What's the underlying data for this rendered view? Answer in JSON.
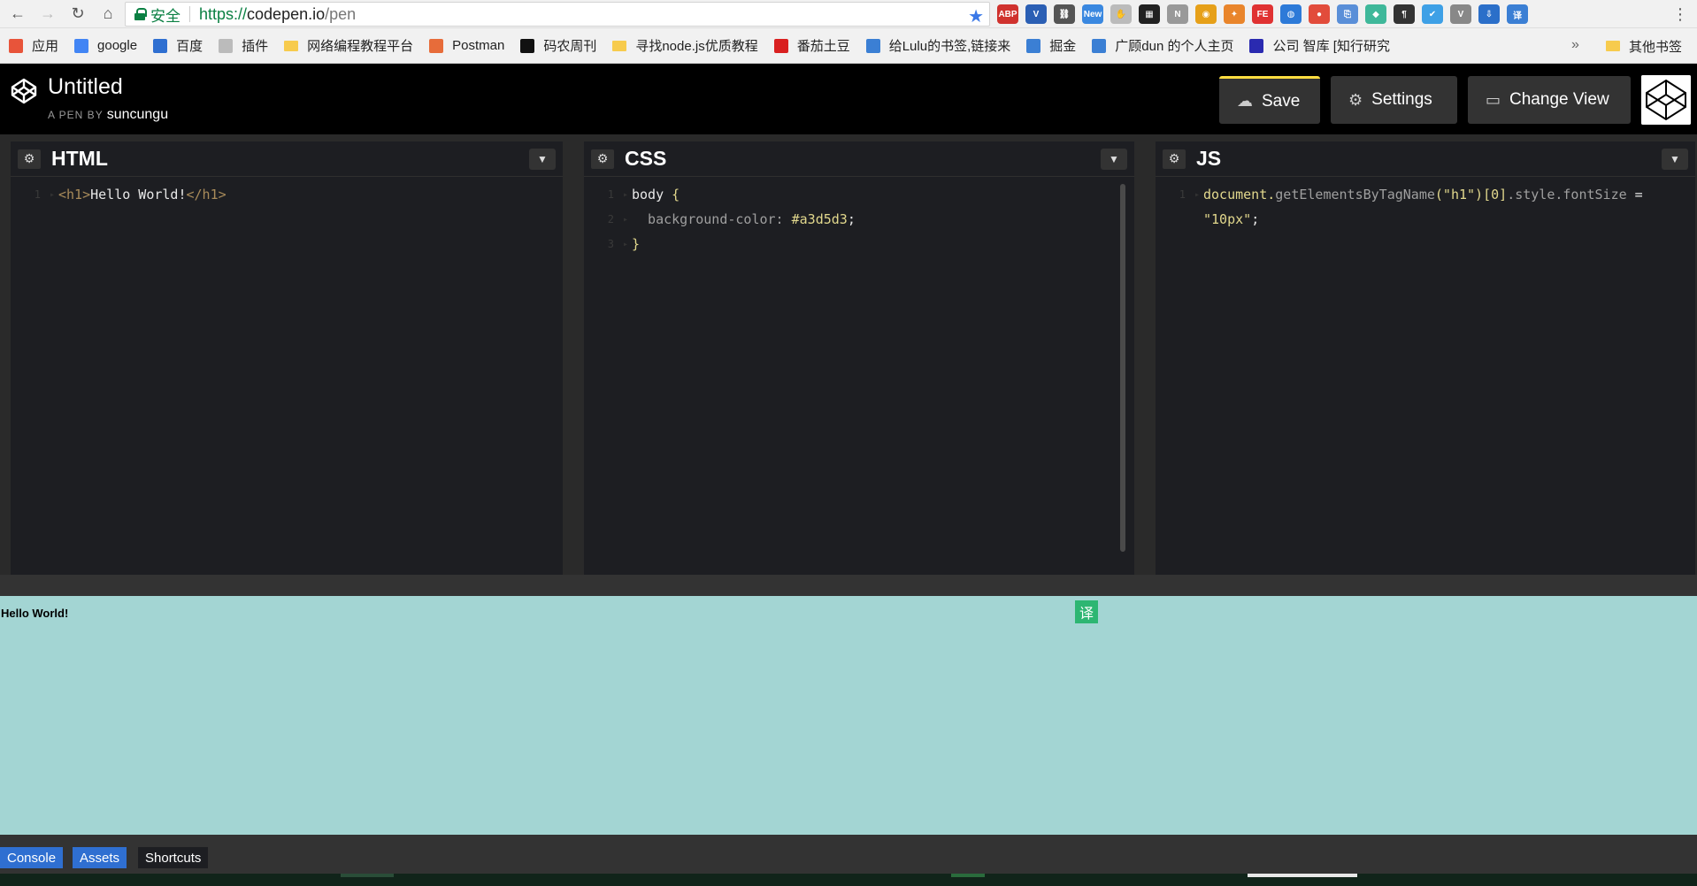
{
  "browser": {
    "secure_label": "安全",
    "url_scheme": "https://",
    "url_host": "codepen.io",
    "url_path": "/pen",
    "extensions": [
      {
        "name": "abp-icon",
        "label": "ABP",
        "color": "#d0322e"
      },
      {
        "name": "vue-icon",
        "label": "V",
        "color": "#2b5fb4"
      },
      {
        "name": "link-icon",
        "label": "⛓",
        "color": "#555555"
      },
      {
        "name": "new-icon",
        "label": "New",
        "color": "#3a88e0"
      },
      {
        "name": "hand-icon",
        "label": "✋",
        "color": "#bbbbbb"
      },
      {
        "name": "qr-icon",
        "label": "▦",
        "color": "#222222"
      },
      {
        "name": "n-icon",
        "label": "N",
        "color": "#999999"
      },
      {
        "name": "chrome-icon",
        "label": "◉",
        "color": "#e6a019"
      },
      {
        "name": "puzzle-icon",
        "label": "✦",
        "color": "#e9852b"
      },
      {
        "name": "fe-icon",
        "label": "FE",
        "color": "#e03232"
      },
      {
        "name": "globe-icon",
        "label": "◍",
        "color": "#2d7ad8"
      },
      {
        "name": "pin-icon",
        "label": "●",
        "color": "#e24c3b"
      },
      {
        "name": "clip-icon",
        "label": "⎘",
        "color": "#5a8fd8"
      },
      {
        "name": "diamond-icon",
        "label": "◆",
        "color": "#3fb89a"
      },
      {
        "name": "pilcrow-icon",
        "label": "¶",
        "color": "#333333"
      },
      {
        "name": "check-icon",
        "label": "✔",
        "color": "#3ea0e6"
      },
      {
        "name": "v-icon",
        "label": "V",
        "color": "#888888"
      },
      {
        "name": "down-icon",
        "label": "⇩",
        "color": "#2b6fc9"
      },
      {
        "name": "translate-ext-icon",
        "label": "译",
        "color": "#3b7fd4"
      }
    ]
  },
  "bookmarks": [
    {
      "name": "apps",
      "label": "应用",
      "color": "#e8543a"
    },
    {
      "name": "google",
      "label": "google",
      "color": "#4285f4"
    },
    {
      "name": "baidu",
      "label": "百度",
      "color": "#2f6fd1"
    },
    {
      "name": "plugins",
      "label": "插件",
      "color": "#bbbbbb"
    },
    {
      "name": "folder-1",
      "label": "网络编程教程平台",
      "folder": true
    },
    {
      "name": "postman",
      "label": "Postman",
      "color": "#e76c3a"
    },
    {
      "name": "mano",
      "label": "码农周刊",
      "color": "#111111"
    },
    {
      "name": "folder-2",
      "label": "寻找node.js优质教程",
      "folder": true
    },
    {
      "name": "tomato",
      "label": "番茄土豆",
      "color": "#d92020"
    },
    {
      "name": "lulu",
      "label": "给Lulu的书签,链接来",
      "color": "#3b7fd4"
    },
    {
      "name": "juejin",
      "label": "掘金",
      "color": "#3b7fd4"
    },
    {
      "name": "guanggudun",
      "label": "广顾dun 的个人主页",
      "color": "#3b7fd4"
    },
    {
      "name": "zhiku",
      "label": "公司 智库 [知行研究",
      "color": "#2a2ab0"
    }
  ],
  "bookmarks_more": "»",
  "bookmarks_other": "其他书签",
  "pen": {
    "title": "Untitled",
    "by_label": "A PEN BY",
    "author": "suncungu"
  },
  "header_buttons": {
    "save": "Save",
    "settings": "Settings",
    "change_view": "Change View"
  },
  "editors": {
    "html": {
      "label": "HTML",
      "lines": [
        {
          "n": "1",
          "parts": [
            {
              "t": "<h1>",
              "c": "c-tag"
            },
            {
              "t": "Hello World!",
              "c": "c-text"
            },
            {
              "t": "</h1>",
              "c": "c-tag"
            }
          ]
        }
      ]
    },
    "css": {
      "label": "CSS",
      "lines": [
        {
          "n": "1",
          "parts": [
            {
              "t": "body ",
              "c": "c-sel"
            },
            {
              "t": "{",
              "c": "c-brace"
            }
          ]
        },
        {
          "n": "2",
          "parts": [
            {
              "t": "  background-color: ",
              "c": "c-prop"
            },
            {
              "t": "#a3d5d3",
              "c": "c-val"
            },
            {
              "t": ";",
              "c": "c-text"
            }
          ]
        },
        {
          "n": "3",
          "parts": [
            {
              "t": "}",
              "c": "c-brace"
            }
          ]
        }
      ]
    },
    "js": {
      "label": "JS",
      "lines": [
        {
          "n": "1",
          "parts": [
            {
              "t": "document.",
              "c": "c-obj"
            },
            {
              "t": "getElementsByTagName",
              "c": "c-meth"
            },
            {
              "t": "(\"h1\")",
              "c": "c-str"
            },
            {
              "t": "[0]",
              "c": "c-obj"
            },
            {
              "t": ".style.fontSize",
              "c": "c-meth"
            },
            {
              "t": " =",
              "c": "c-text"
            }
          ]
        },
        {
          "n": "",
          "parts": [
            {
              "t": "\"10px\"",
              "c": "c-str"
            },
            {
              "t": ";",
              "c": "c-text"
            }
          ]
        }
      ]
    }
  },
  "preview": {
    "heading": "Hello World!",
    "translate_label": "译",
    "background": "#a3d5d3"
  },
  "bottom_bar": {
    "console": "Console",
    "assets": "Assets",
    "shortcuts": "Shortcuts"
  },
  "colors": {
    "accent_save": "#ffdd40",
    "highlight": "#2f6fd1",
    "editor_bg": "#1d1e22"
  }
}
